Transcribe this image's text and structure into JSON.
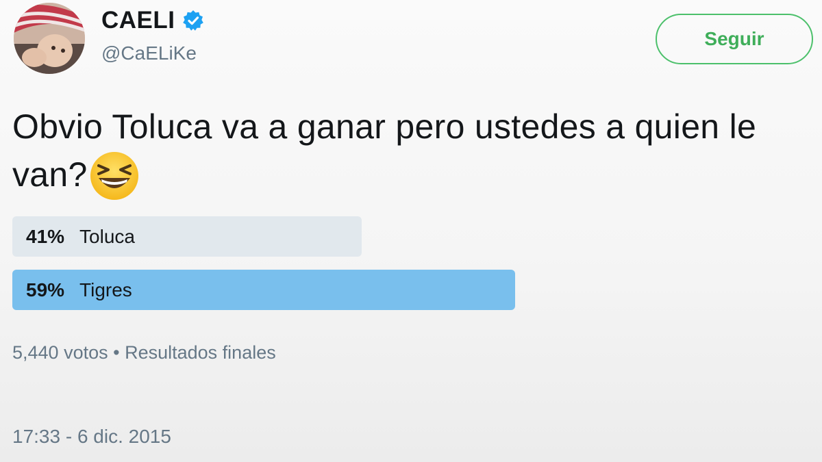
{
  "user": {
    "display_name": "CAELI",
    "handle": "@CaELiKe",
    "verified": true,
    "verified_icon": "verified-badge-icon"
  },
  "follow_button": {
    "label": "Seguir"
  },
  "tweet": {
    "text": "Obvio Toluca va a ganar pero ustedes a quien le van?",
    "emoji": "grinning-squinting-face-emoji"
  },
  "poll": {
    "options": [
      {
        "percent": "41%",
        "value": 41,
        "label": "Toluca",
        "winner": false
      },
      {
        "percent": "59%",
        "value": 59,
        "label": "Tigres",
        "winner": true
      }
    ],
    "votes": "5,440 votos",
    "separator": "•",
    "status": "Resultados finales"
  },
  "timestamp": "17:33 - 6 dic. 2015",
  "colors": {
    "accent_blue": "#1da1f2",
    "winner_bar": "#79bfed",
    "loser_bar": "#e1e8ed",
    "follow_green": "#3fae5a",
    "muted_text": "#657786"
  }
}
